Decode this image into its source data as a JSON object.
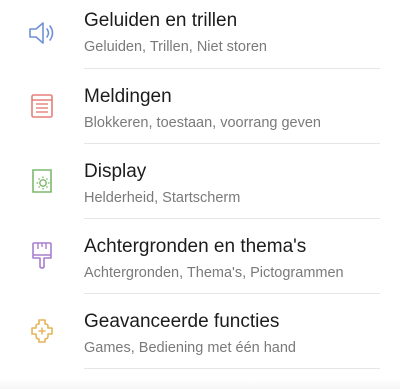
{
  "settings": {
    "items": [
      {
        "title": "Geluiden en trillen",
        "subtitle": "Geluiden, Trillen, Niet storen",
        "icon": "speaker-icon",
        "color": "#6f8fd6"
      },
      {
        "title": "Meldingen",
        "subtitle": "Blokkeren, toestaan, voorrang geven",
        "icon": "notifications-list-icon",
        "color": "#e57f78"
      },
      {
        "title": "Display",
        "subtitle": "Helderheid, Startscherm",
        "icon": "display-brightness-icon",
        "color": "#7cb86b"
      },
      {
        "title": "Achtergronden en thema's",
        "subtitle": "Achtergronden, Thema's, Pictogrammen",
        "icon": "paintbrush-icon",
        "color": "#a77fcf"
      },
      {
        "title": "Geavanceerde functies",
        "subtitle": "Games, Bediening met één hand",
        "icon": "puzzle-plus-icon",
        "color": "#e5b45a"
      }
    ]
  }
}
